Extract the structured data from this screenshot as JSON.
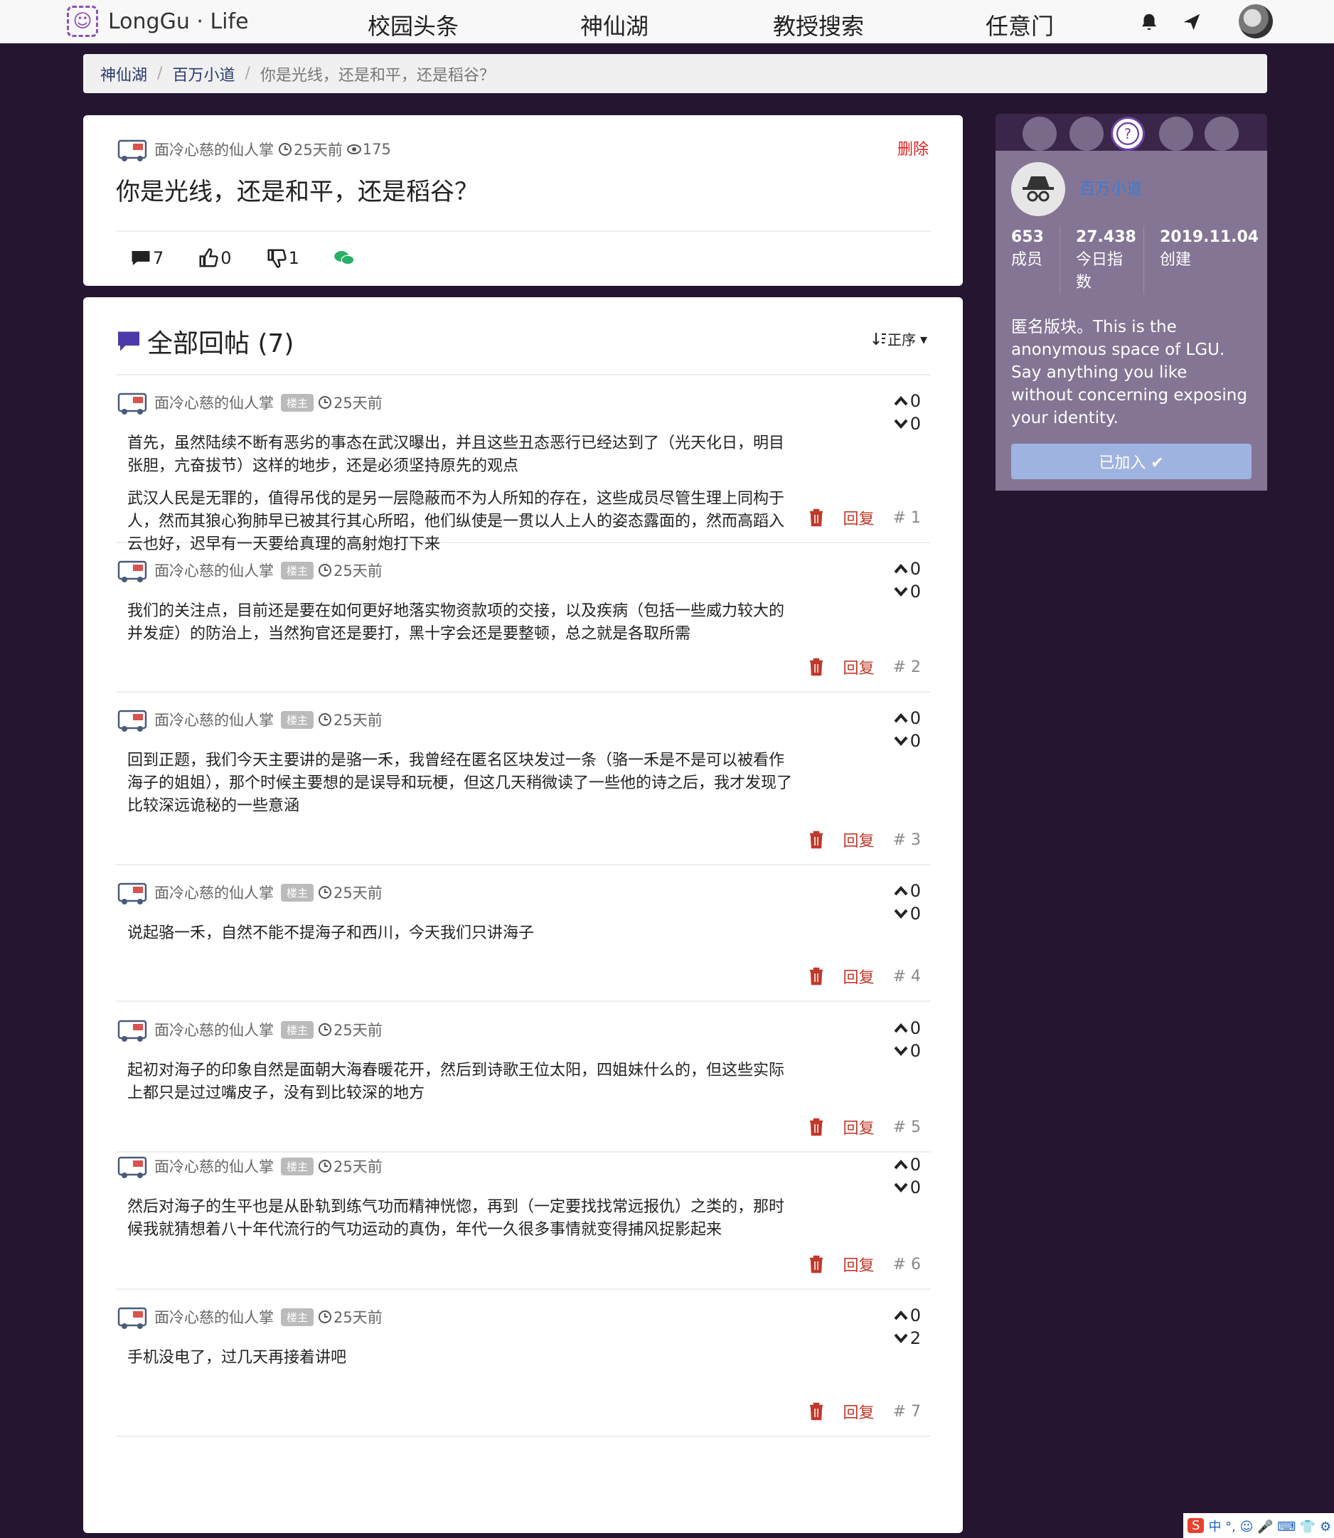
{
  "nav": {
    "logo_text": "LongGu · Life",
    "links": [
      "校园头条",
      "神仙湖",
      "教授搜索",
      "任意门"
    ]
  },
  "breadcrumb": {
    "items": [
      "神仙湖",
      "百万小道"
    ],
    "current": "你是光线，还是和平，还是稻谷？"
  },
  "post": {
    "author": "面冷心慈的仙人掌",
    "time": "25天前",
    "views": "175",
    "delete_label": "删除",
    "title": "你是光线，还是和平，还是稻谷？",
    "comments": "7",
    "likes": "0",
    "dislikes": "1"
  },
  "replies": {
    "title": "全部回帖 (7)",
    "sort_label": "正序",
    "badge": "楼主",
    "reply_label": "回复",
    "items": [
      {
        "author": "面冷心慈的仙人掌",
        "time": "25天前",
        "up": "0",
        "down": "0",
        "floor": "# 1",
        "paragraphs": [
          "首先，虽然陆续不断有恶劣的事态在武汉曝出，并且这些丑态恶行已经达到了（光天化日，明目张胆，亢奋拔节）这样的地步，还是必须坚持原先的观点",
          "武汉人民是无罪的，值得吊伐的是另一层隐蔽而不为人所知的存在，这些成员尽管生理上同构于人，然而其狼心狗肺早已被其行其心所昭，他们纵使是一贯以人上人的姿态露面的，然而高蹈入云也好，迟早有一天要给真理的高射炮打下来"
        ]
      },
      {
        "author": "面冷心慈的仙人掌",
        "time": "25天前",
        "up": "0",
        "down": "0",
        "floor": "# 2",
        "paragraphs": [
          "我们的关注点，目前还是要在如何更好地落实物资款项的交接，以及疾病（包括一些威力较大的并发症）的防治上，当然狗官还是要打，黑十字会还是要整顿，总之就是各取所需"
        ]
      },
      {
        "author": "面冷心慈的仙人掌",
        "time": "25天前",
        "up": "0",
        "down": "0",
        "floor": "# 3",
        "paragraphs": [
          "回到正题，我们今天主要讲的是骆一禾，我曾经在匿名区块发过一条（骆一禾是不是可以被看作海子的姐姐），那个时候主要想的是误导和玩梗，但这几天稍微读了一些他的诗之后，我才发现了比较深远诡秘的一些意涵"
        ]
      },
      {
        "author": "面冷心慈的仙人掌",
        "time": "25天前",
        "up": "0",
        "down": "0",
        "floor": "# 4",
        "paragraphs": [
          "说起骆一禾，自然不能不提海子和西川，今天我们只讲海子"
        ]
      },
      {
        "author": "面冷心慈的仙人掌",
        "time": "25天前",
        "up": "0",
        "down": "0",
        "floor": "# 5",
        "paragraphs": [
          "起初对海子的印象自然是面朝大海春暖花开，然后到诗歌王位太阳，四姐妹什么的，但这些实际上都只是过过嘴皮子，没有到比较深的地方"
        ]
      },
      {
        "author": "面冷心慈的仙人掌",
        "time": "25天前",
        "up": "0",
        "down": "0",
        "floor": "# 6",
        "paragraphs": [
          "然后对海子的生平也是从卧轨到练气功而精神恍惚，再到（一定要找找常远报仇）之类的，那时候我就猜想着八十年代流行的气功运动的真伪，年代一久很多事情就变得捕风捉影起来"
        ]
      },
      {
        "author": "面冷心慈的仙人掌",
        "time": "25天前",
        "up": "0",
        "down": "2",
        "floor": "# 7",
        "paragraphs": [
          "手机没电了，过几天再接着讲吧"
        ]
      }
    ]
  },
  "sidebar": {
    "name": "百万小道",
    "stats": [
      {
        "num": "653",
        "label": "成员"
      },
      {
        "num": "27.438",
        "label": "今日指数"
      },
      {
        "num": "2019.11.04",
        "label": "创建"
      }
    ],
    "description": "匿名版块。This is the anonymous space of LGU. Say anything you like without concerning exposing your identity.",
    "joined_label": "已加入 ✔"
  },
  "ime": "中 °, ☺ 🎤 ⌨ 👕 ⚙"
}
